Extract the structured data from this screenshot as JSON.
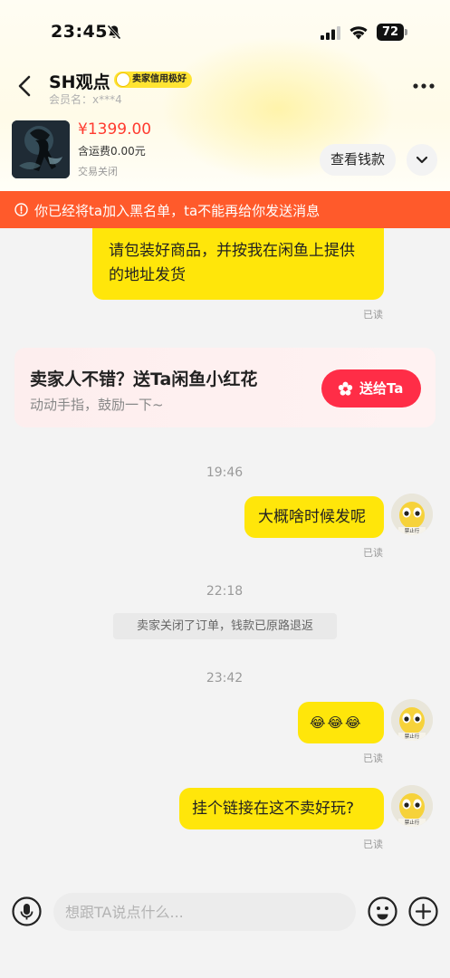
{
  "status_bar": {
    "time": "23:45",
    "battery": "72"
  },
  "header": {
    "name": "SH观点",
    "badge": "卖家信用极好",
    "member": "会员名：x***4"
  },
  "product": {
    "price": "¥1399.00",
    "shipping": "含运费0.00元",
    "status": "交易关闭",
    "view_button": "查看钱款"
  },
  "banner": {
    "text": "你已经将ta加入黑名单，ta不能再给你发送消息"
  },
  "messages": {
    "msg1": "请包装好商品，并按我在闲鱼上提供的地址发货",
    "read": "已读",
    "time1": "19:46",
    "msg2": "大概啥时候发呢",
    "time2": "22:18",
    "system_note": "卖家关闭了订单，钱款已原路退返",
    "time3": "23:42",
    "msg3": "😂😂😂",
    "msg4": "挂个链接在这不卖好玩?"
  },
  "card": {
    "title": "卖家人不错？送Ta闲鱼小红花",
    "subtitle": "动动手指，鼓励一下~",
    "button": "送给Ta"
  },
  "input": {
    "placeholder": "想跟TA说点什么..."
  },
  "avatar": {
    "label": "禁止行"
  },
  "colors": {
    "accent": "#ffe60a",
    "banner": "#ff5a2b",
    "price": "#ff3b30",
    "give": "#ff2d47"
  }
}
